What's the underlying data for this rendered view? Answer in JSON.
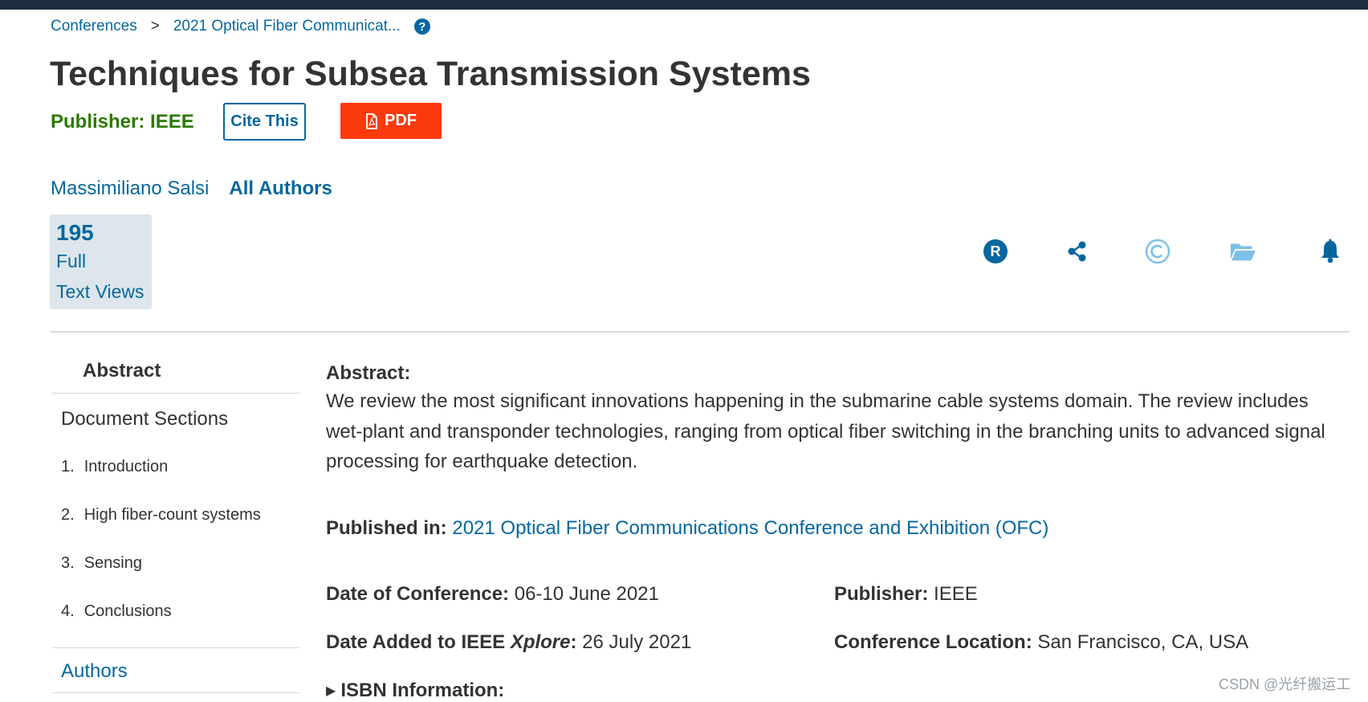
{
  "breadcrumb": {
    "conferences": "Conferences",
    "separator": ">",
    "conference": "2021 Optical Fiber Communicat..."
  },
  "document": {
    "title": "Techniques for Subsea Transmission Systems",
    "publisher_label": "Publisher:",
    "publisher_value": "IEEE",
    "cite_label": "Cite This",
    "pdf_label": "PDF"
  },
  "authors": {
    "first": "Massimiliano Salsi",
    "all_label": "All Authors"
  },
  "metrics": {
    "count": "195",
    "line1": "Full",
    "line2": "Text Views"
  },
  "tools": [
    "rights-permissions-icon",
    "share-icon",
    "copyright-icon",
    "folder-icon",
    "alert-bell-icon"
  ],
  "sidebar": {
    "abstract": "Abstract",
    "sections_heading": "Document Sections",
    "sections": [
      {
        "num": "1.",
        "label": "Introduction"
      },
      {
        "num": "2.",
        "label": "High fiber-count systems"
      },
      {
        "num": "3.",
        "label": "Sensing"
      },
      {
        "num": "4.",
        "label": "Conclusions"
      }
    ],
    "authors": "Authors"
  },
  "abstract": {
    "heading": "Abstract:",
    "text": "We review the most significant innovations happening in the submarine cable systems domain. The review includes wet-plant and transponder technologies, ranging from optical fiber switching in the branching units to advanced signal processing for earthquake detection."
  },
  "published_in": {
    "label": "Published in:",
    "value": "2021 Optical Fiber Communications Conference and Exhibition (OFC)"
  },
  "details": {
    "date_conf_label": "Date of Conference:",
    "date_conf_value": "06-10 June 2021",
    "date_added_label_pre": "Date Added to IEEE ",
    "date_added_label_em": "Xplore",
    "date_added_label_post": ":",
    "date_added_value": "26 July 2021",
    "publisher_label": "Publisher:",
    "publisher_value": "IEEE",
    "location_label": "Conference Location:",
    "location_value": "San Francisco, CA, USA"
  },
  "isbn": {
    "label": "ISBN Information:"
  },
  "watermark": "CSDN @光纤搬运工",
  "colors": {
    "link": "#06679e",
    "publisher_green": "#2b7a00",
    "pdf_button": "#fa3a0d",
    "top_bar": "#1d2f3e",
    "metrics_bg": "#dce6ec"
  }
}
